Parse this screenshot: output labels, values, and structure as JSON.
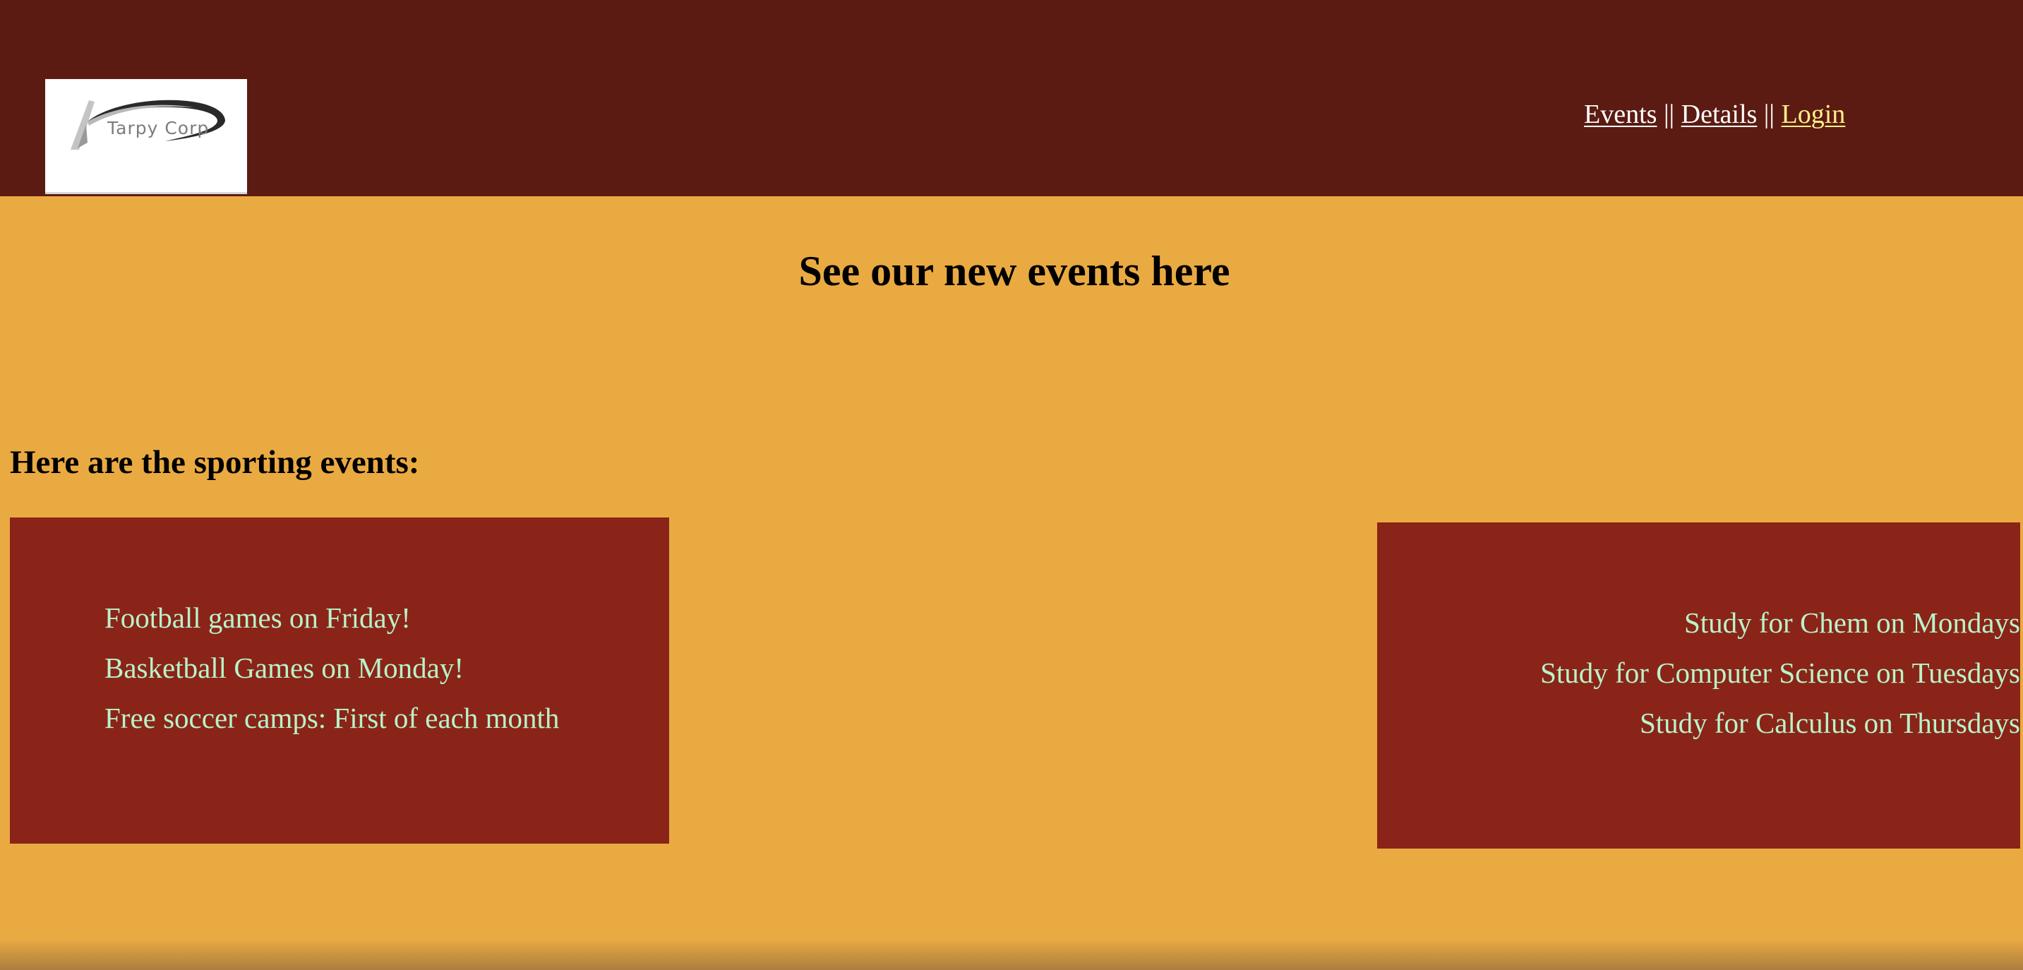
{
  "header": {
    "logo_text": "Tarpy Corp",
    "nav": {
      "events_label": "Events",
      "details_label": "Details",
      "login_label": "Login",
      "separator": "||"
    }
  },
  "main": {
    "title": "See our new events here",
    "sporting_heading": "Here are the sporting events:",
    "sporting_events": [
      "Football games on Friday!",
      "Basketball Games on Monday!",
      "Free soccer camps: First of each month"
    ],
    "study_events": [
      "Study for Chem on Mondays",
      "Study for Computer Science on Tuesdays",
      "Study for Calculus on Thursdays"
    ]
  },
  "colors": {
    "header_bg": "#5b1b12",
    "page_bg": "#eaaa42",
    "panel_bg": "#8a2418",
    "panel_text": "#b9f2c9",
    "active_link": "#ffef8a"
  }
}
